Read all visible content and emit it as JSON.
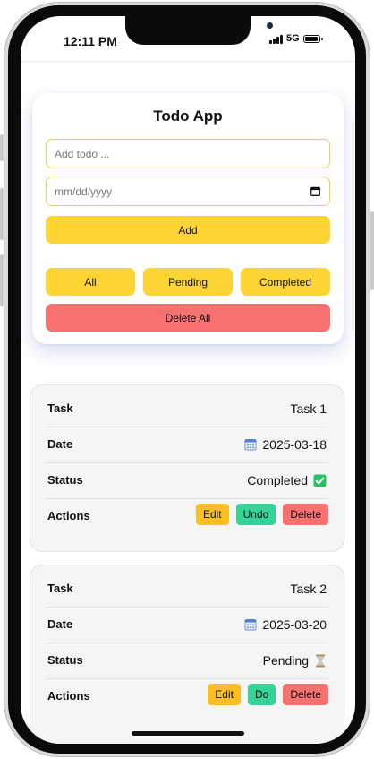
{
  "status_bar": {
    "time": "12:11 PM",
    "network": "5G",
    "battery_level": 0.85
  },
  "app": {
    "title": "Todo App",
    "todo_input": {
      "placeholder": "Add todo ...",
      "value": ""
    },
    "date_input": {
      "placeholder": "mm/dd/yyyy",
      "value": ""
    },
    "add_label": "Add",
    "filters": {
      "all": "All",
      "pending": "Pending",
      "completed": "Completed"
    },
    "delete_all_label": "Delete All"
  },
  "labels": {
    "task": "Task",
    "date": "Date",
    "status": "Status",
    "actions": "Actions"
  },
  "tasks": [
    {
      "task": "Task 1",
      "date": "2025-03-18",
      "status": "Completed",
      "status_icon": "check-box-icon",
      "actions": {
        "edit": "Edit",
        "toggle": "Undo",
        "delete": "Delete"
      }
    },
    {
      "task": "Task 2",
      "date": "2025-03-20",
      "status": "Pending",
      "status_icon": "hourglass-icon",
      "actions": {
        "edit": "Edit",
        "toggle": "Do",
        "delete": "Delete"
      }
    }
  ],
  "colors": {
    "primary_yellow": "#fcd535",
    "danger_red": "#f87171",
    "success_green": "#34d399",
    "edit_amber": "#fbbf24"
  }
}
